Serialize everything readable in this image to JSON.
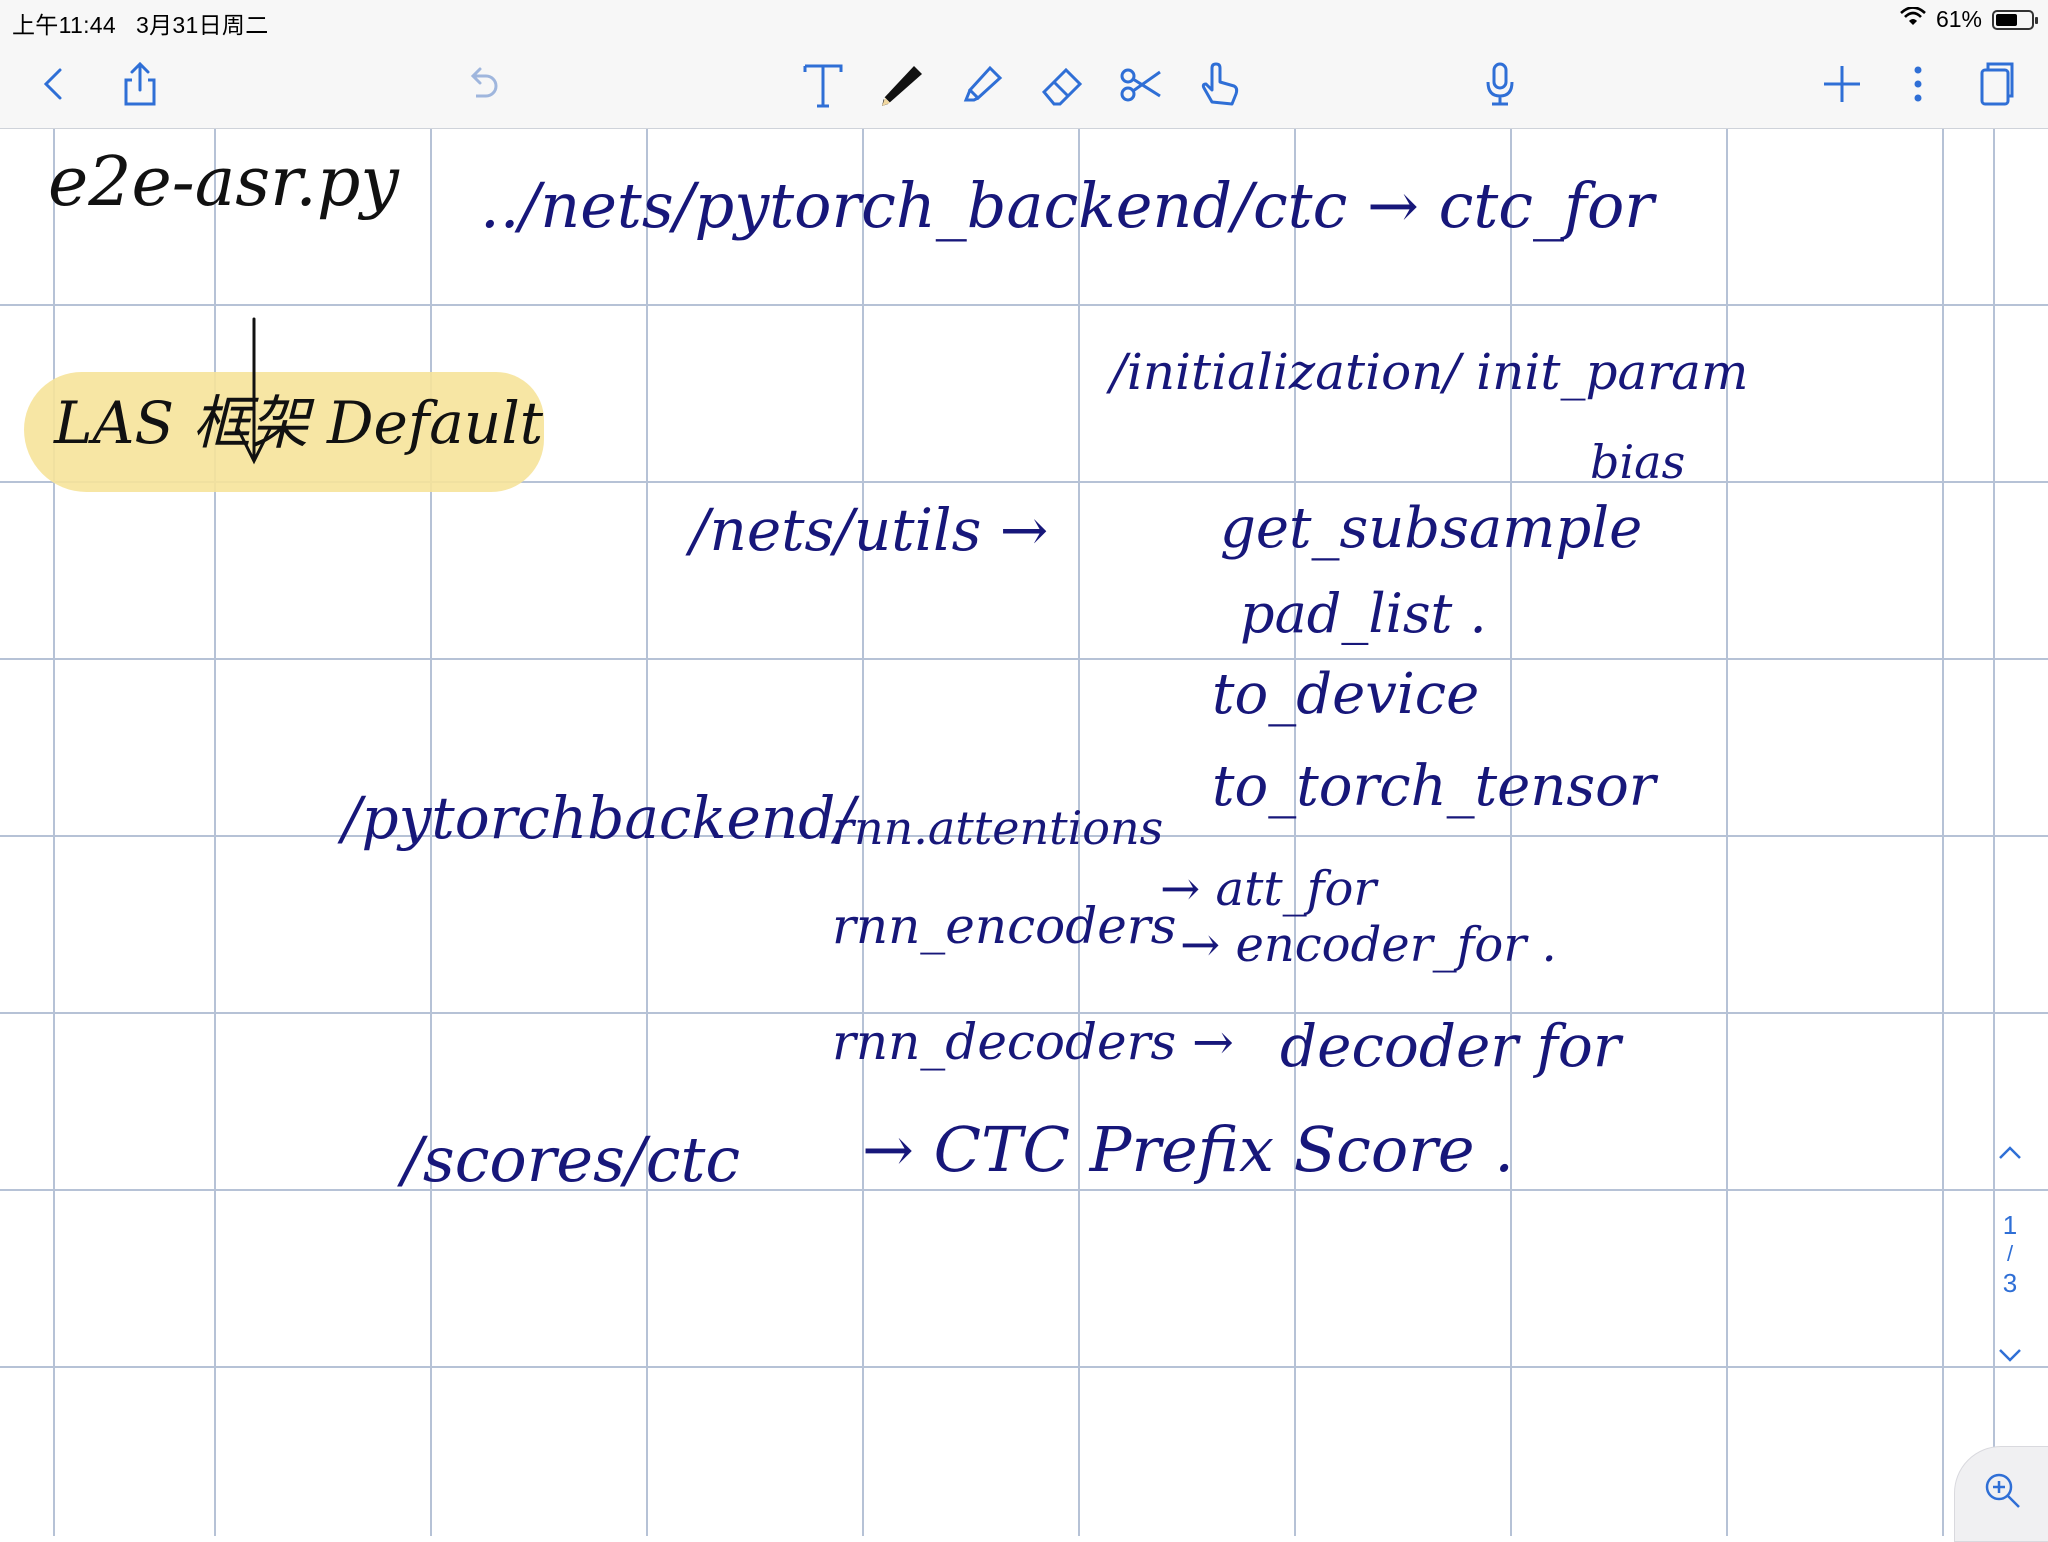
{
  "status_bar": {
    "time": "上午11:44",
    "date": "3月31日周二",
    "wifi_icon": "wifi-icon",
    "battery_percent": "61%",
    "battery_level": 0.61
  },
  "toolbar": {
    "left": [
      "back-icon",
      "share-icon",
      "undo-icon"
    ],
    "tools": [
      "text-tool-icon",
      "pen-icon",
      "highlighter-icon",
      "eraser-icon",
      "scissors-icon",
      "hand-icon"
    ],
    "right": [
      "microphone-icon",
      "add-icon",
      "more-icon",
      "pages-icon"
    ],
    "accent_color": "#2f6fd6"
  },
  "notebook": {
    "ink_color": "#17177a",
    "highlight_color": "#f6e39a",
    "lines": [
      {
        "text": "e2e-asr.py",
        "ink": "black"
      },
      {
        "text": "../nets/pytorch_backend/ctc → ctc_for"
      },
      {
        "text": "LAS 框架 Default",
        "ink": "black",
        "highlighted": true
      },
      {
        "text": "/initialization/ init_param"
      },
      {
        "text": "bias"
      },
      {
        "text": "/nets/utils →"
      },
      {
        "text": "get_subsample"
      },
      {
        "text": "pad_list ."
      },
      {
        "text": "to_device"
      },
      {
        "text": "to_torch_tensor"
      },
      {
        "text": "/pytorchbackend/"
      },
      {
        "text": "rnn.attentions"
      },
      {
        "text": "→ att_for"
      },
      {
        "text": "rnn_encoders"
      },
      {
        "text": "→ encoder_for ."
      },
      {
        "text": "rnn_decoders →"
      },
      {
        "text": "decoder for"
      },
      {
        "text": "/scores/ctc"
      },
      {
        "text": "→ CTC Prefix Score ."
      }
    ]
  },
  "page_nav": {
    "current": "1",
    "separator": "/",
    "total": "3",
    "up_icon": "chevron-up-icon",
    "down_icon": "chevron-down-icon",
    "zoom_icon": "zoom-in-icon"
  }
}
